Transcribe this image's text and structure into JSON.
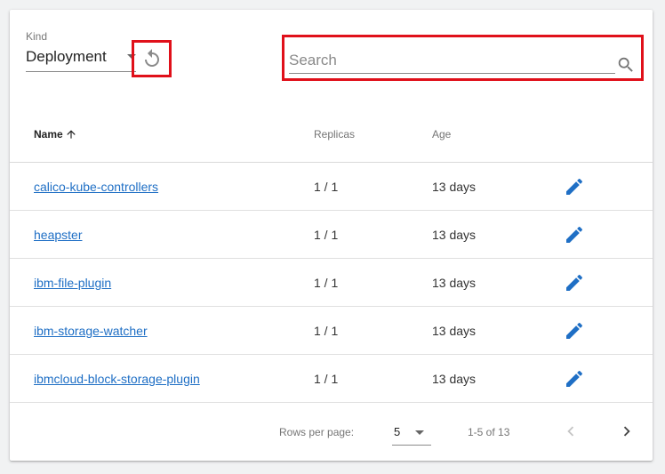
{
  "toolbar": {
    "kind_label": "Kind",
    "kind_value": "Deployment",
    "search_placeholder": "Search",
    "search_value": ""
  },
  "table": {
    "columns": {
      "name": "Name",
      "replicas": "Replicas",
      "age": "Age"
    },
    "sort_indicator": "arrow-up-icon",
    "rows": [
      {
        "name": "calico-kube-controllers",
        "replicas": "1 / 1",
        "age": "13 days"
      },
      {
        "name": "heapster",
        "replicas": "1 / 1",
        "age": "13 days"
      },
      {
        "name": "ibm-file-plugin",
        "replicas": "1 / 1",
        "age": "13 days"
      },
      {
        "name": "ibm-storage-watcher",
        "replicas": "1 / 1",
        "age": "13 days"
      },
      {
        "name": "ibmcloud-block-storage-plugin",
        "replicas": "1 / 1",
        "age": "13 days"
      }
    ]
  },
  "footer": {
    "rows_per_page_label": "Rows per page:",
    "rows_per_page_value": "5",
    "range": "1-5 of 13"
  },
  "colors": {
    "accent": "#1f6fc5",
    "highlight": "#e0101a"
  }
}
